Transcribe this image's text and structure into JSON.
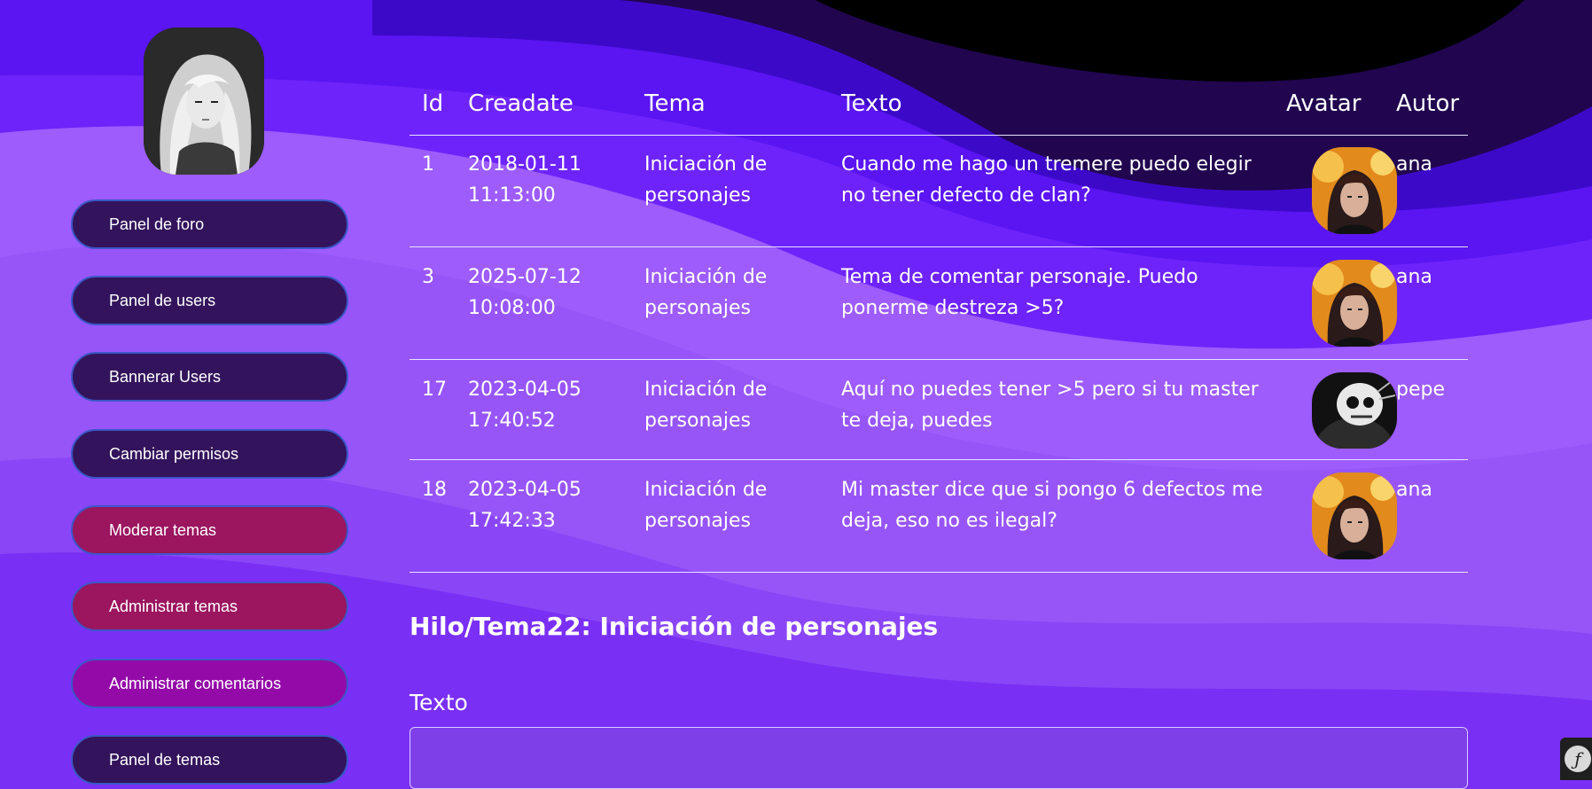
{
  "sidebar": {
    "items": [
      {
        "label": "Panel de foro",
        "style": "dark"
      },
      {
        "label": "Panel de users",
        "style": "dark"
      },
      {
        "label": "Bannerar Users",
        "style": "dark"
      },
      {
        "label": "Cambiar permisos",
        "style": "dark"
      },
      {
        "label": "Moderar temas",
        "style": "rose"
      },
      {
        "label": "Administrar temas",
        "style": "rose"
      },
      {
        "label": "Administrar comentarios",
        "style": "magenta"
      },
      {
        "label": "Panel de temas",
        "style": "dark"
      }
    ]
  },
  "table": {
    "headers": {
      "id": "Id",
      "created": "Creadate",
      "tema": "Tema",
      "texto": "Texto",
      "avatar": "Avatar",
      "autor": "Autor"
    },
    "rows": [
      {
        "id": "1",
        "date": "2018-01-11",
        "time": "11:13:00",
        "tema_1": "Iniciación de",
        "tema_2": "personajes",
        "texto": "Cuando me hago un tremere puedo elegir no tener defecto de clan?",
        "avatar": "ana-avatar",
        "autor": "ana"
      },
      {
        "id": "3",
        "date": "2025-07-12",
        "time": "10:08:00",
        "tema_1": "Iniciación de",
        "tema_2": "personajes",
        "texto": "Tema de comentar personaje. Puedo ponerme destreza >5?",
        "avatar": "ana-avatar",
        "autor": "ana"
      },
      {
        "id": "17",
        "date": "2023-04-05",
        "time": "17:40:52",
        "tema_1": "Iniciación de",
        "tema_2": "personajes",
        "texto": "Aquí no puedes tener >5 pero si tu master te deja, puedes",
        "avatar": "pepe-avatar",
        "autor": "pepe"
      },
      {
        "id": "18",
        "date": "2023-04-05",
        "time": "17:42:33",
        "tema_1": "Iniciación de",
        "tema_2": "personajes",
        "texto": "Mi master dice que si pongo 6 defectos me deja, eso no es ilegal?",
        "avatar": "ana-avatar",
        "autor": "ana"
      }
    ]
  },
  "form": {
    "section_title": "Hilo/Tema22: Iniciación de personajes",
    "field_label": "Texto",
    "field_value": ""
  },
  "colors": {
    "background": "#7a2ff5",
    "nav_dark": "#33145c",
    "nav_rose": "#9b155f",
    "nav_magenta": "#940aa8",
    "nav_border": "#3b56c8"
  },
  "icons": {
    "logo": "anime-girl-logo",
    "debug": "symfony-icon"
  }
}
